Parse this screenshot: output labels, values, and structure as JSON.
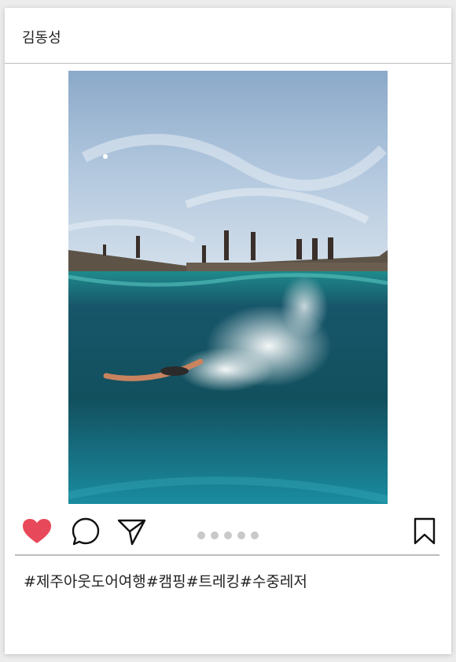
{
  "post": {
    "username": "김동성",
    "caption": "#제주아웃도어여행#캠핑#트레킹#수중레저",
    "liked": true,
    "carousel": {
      "count": 5
    }
  },
  "icons": {
    "like": "heart-icon",
    "comment": "comment-bubble-icon",
    "share": "paper-plane-icon",
    "save": "bookmark-icon"
  },
  "colors": {
    "like": "#e8495a",
    "icon_stroke": "#111111",
    "dot": "#c9c9c9"
  }
}
